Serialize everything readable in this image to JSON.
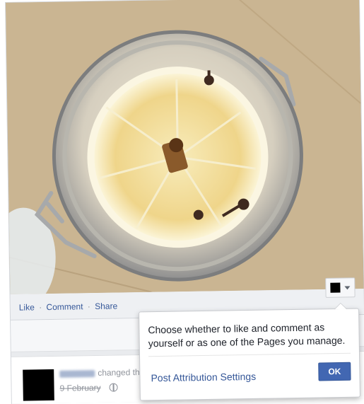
{
  "post": {
    "actions": [
      "Like",
      "Comment",
      "Share"
    ],
    "separator": "·"
  },
  "page_selector": {
    "icon": "black-square-avatar",
    "chevron": "chevron-down-icon"
  },
  "popover": {
    "message": "Choose whether to like and comment as yourself or as one of the Pages you manage.",
    "settings_link": "Post Attribution Settings",
    "ok_label": "OK"
  },
  "activity": {
    "text": "changed their",
    "date": "9 February",
    "privacy_icon": "globe-icon"
  },
  "colors": {
    "link": "#365899",
    "button": "#4267b2",
    "panel": "#e9ebee"
  }
}
